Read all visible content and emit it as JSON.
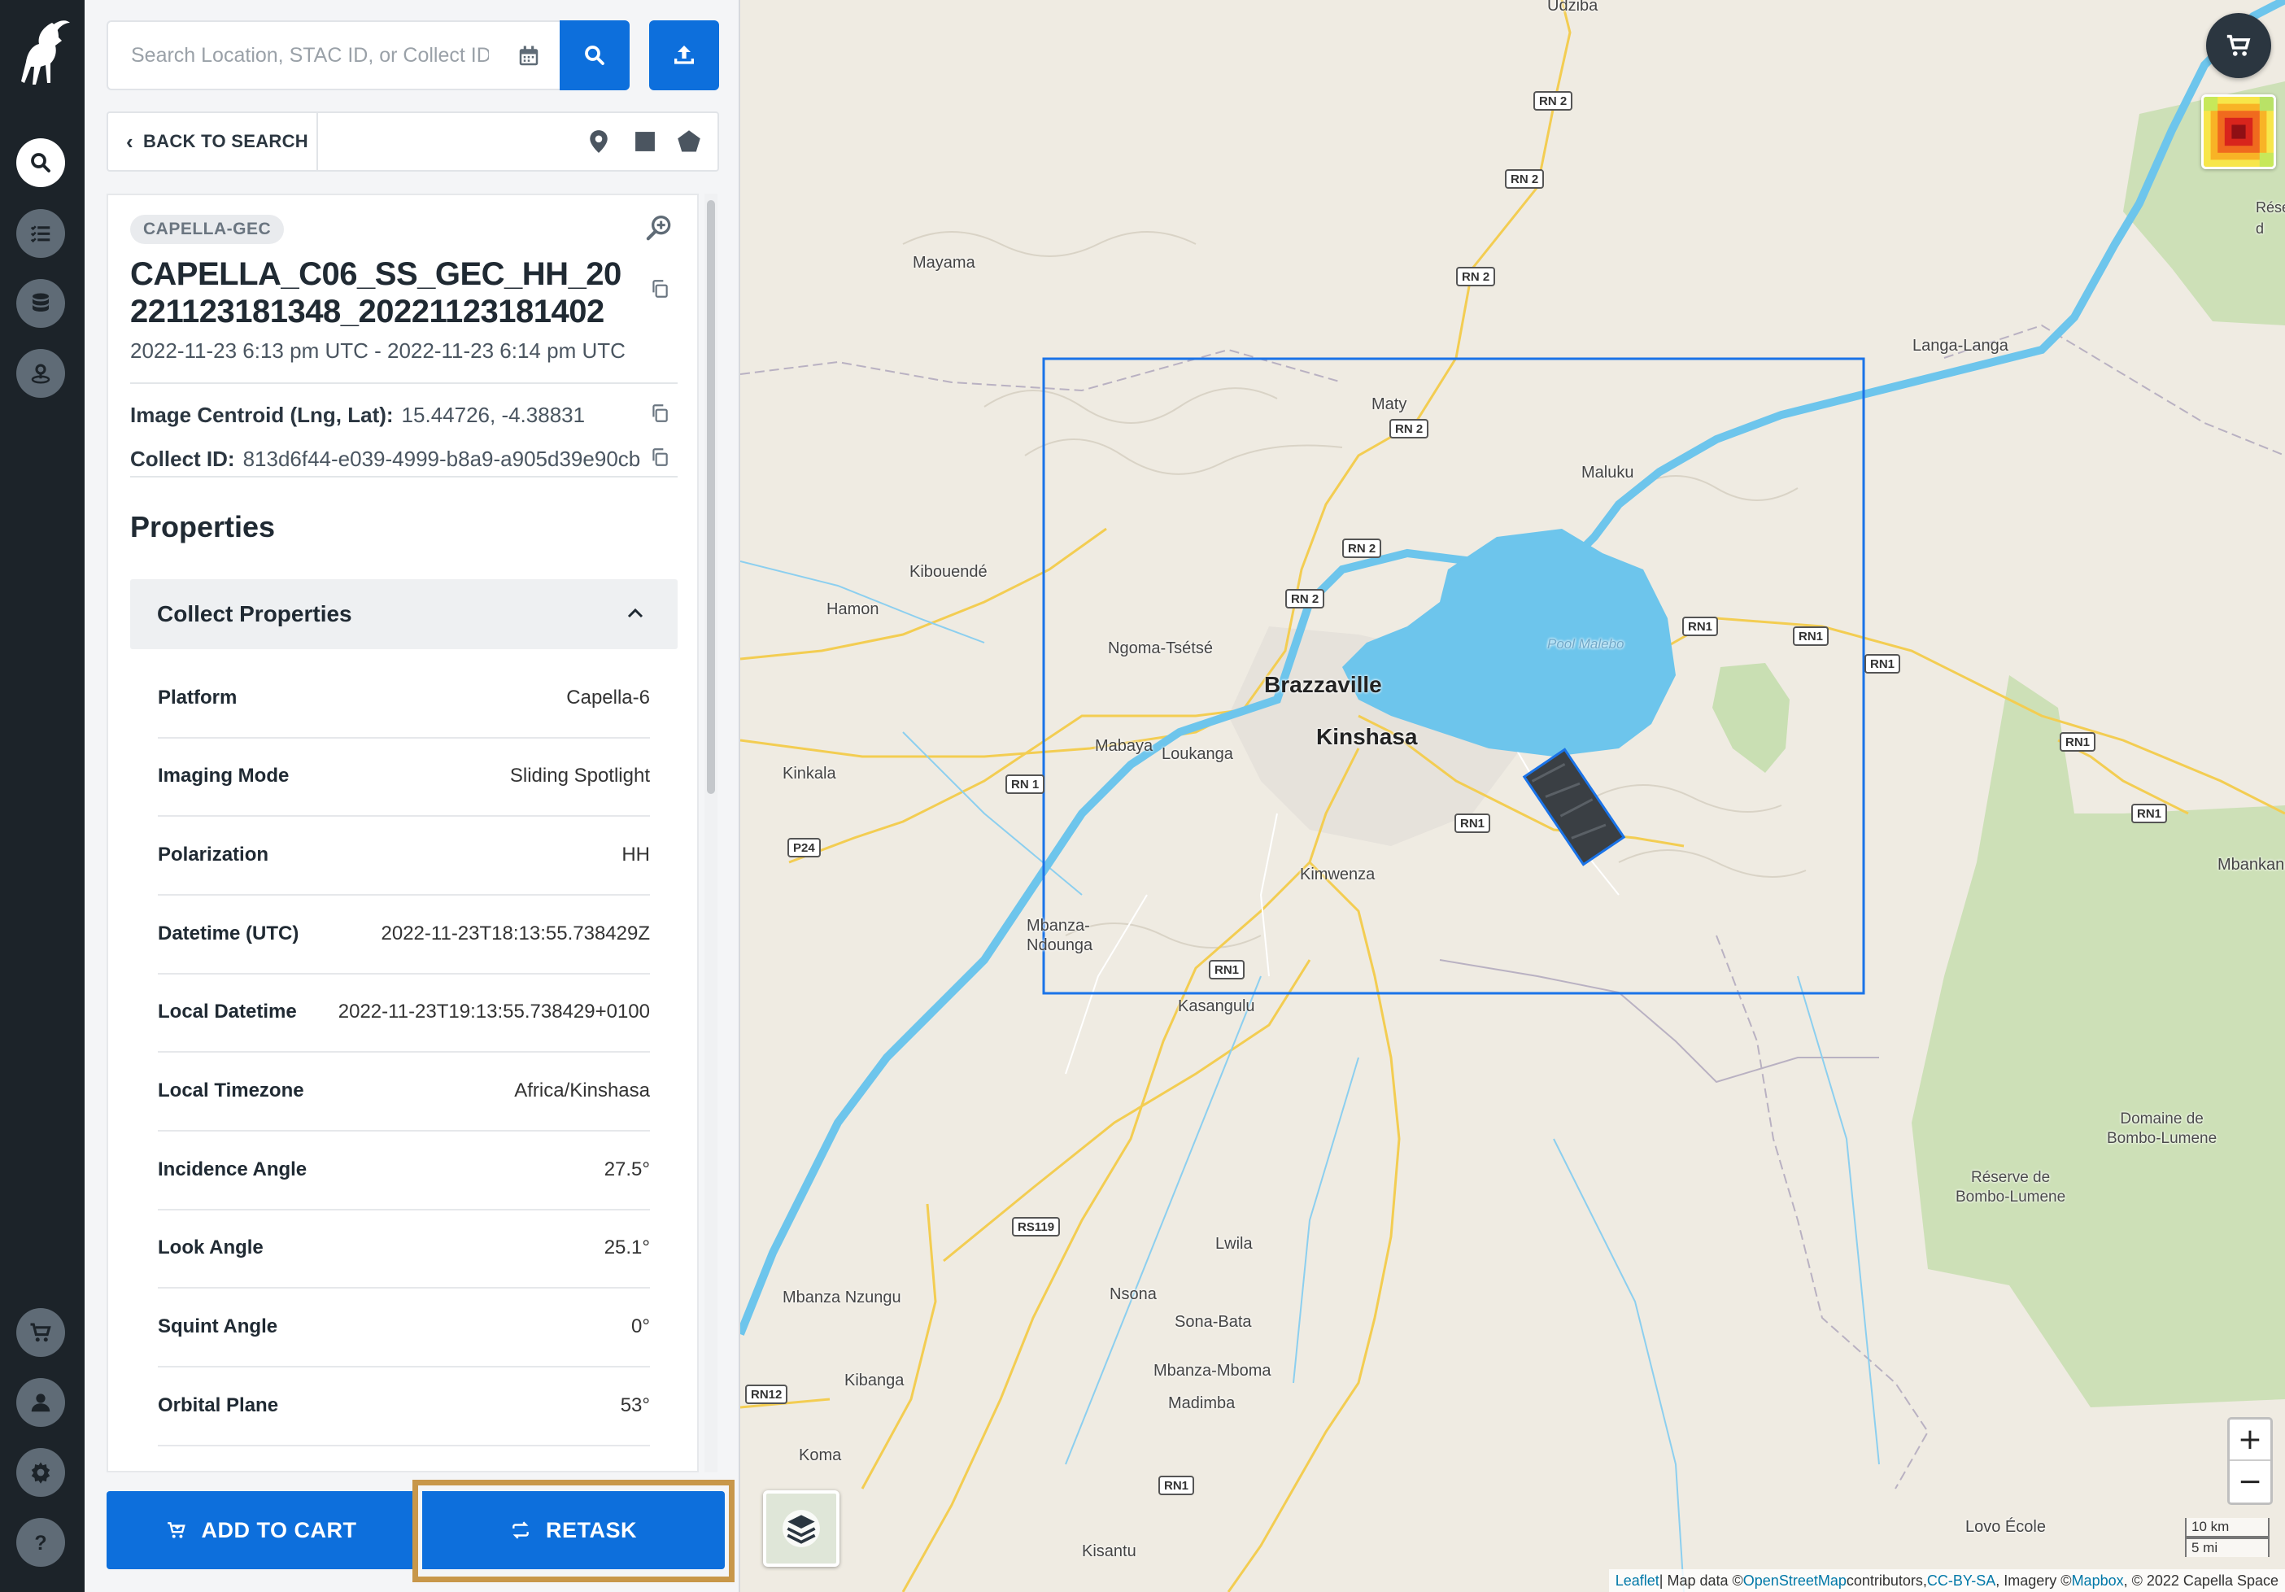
{
  "search": {
    "placeholder": "Search Location, STAC ID, or Collect ID"
  },
  "toolbar": {
    "back_label": "BACK TO SEARCH"
  },
  "detail": {
    "collection_badge": "CAPELLA-GEC",
    "title": "CAPELLA_C06_SS_GEC_HH_20221123181348_20221123181402",
    "datetime_range": "2022-11-23 6:13 pm UTC - 2022-11-23 6:14 pm UTC",
    "centroid_label": "Image Centroid (Lng, Lat):",
    "centroid_value": "15.44726, -4.38831",
    "collect_id_label": "Collect ID:",
    "collect_id_value": "813d6f44-e039-4999-b8a9-a905d39e90cb",
    "properties_heading": "Properties",
    "accordion_title": "Collect Properties",
    "properties": [
      {
        "key": "Platform",
        "value": "Capella-6"
      },
      {
        "key": "Imaging Mode",
        "value": "Sliding Spotlight"
      },
      {
        "key": "Polarization",
        "value": "HH"
      },
      {
        "key": "Datetime (UTC)",
        "value": "2022-11-23T18:13:55.738429Z"
      },
      {
        "key": "Local Datetime",
        "value": "2022-11-23T19:13:55.738429+0100"
      },
      {
        "key": "Local Timezone",
        "value": "Africa/Kinshasa"
      },
      {
        "key": "Incidence Angle",
        "value": "27.5°"
      },
      {
        "key": "Look Angle",
        "value": "25.1°"
      },
      {
        "key": "Squint Angle",
        "value": "0°"
      },
      {
        "key": "Orbital Plane",
        "value": "53°"
      }
    ]
  },
  "actions": {
    "add_to_cart": "ADD TO CART",
    "retask": "RETASK"
  },
  "map": {
    "labels": {
      "udziba": "Udziba",
      "mayama": "Mayama",
      "maty": "Maty",
      "langa_langa": "Langa-Langa",
      "maluku": "Maluku",
      "kibouende": "Kibouendé",
      "hamon": "Hamon",
      "ngoma": "Ngoma-Tsétsé",
      "pool_malebo": "Pool Malebo",
      "brazzaville": "Brazzaville",
      "kinshasa": "Kinshasa",
      "mabaya": "Mabaya",
      "loukanga": "Loukanga",
      "kinkala": "Kinkala",
      "kimwenza": "Kimwenza",
      "mbanza_ndounga": "Mbanza-\nNdounga",
      "kasangulu": "Kasangulu",
      "mbankana": "Mbankana",
      "domaine": "Domaine de\nBombo-Lumene",
      "reserve": "Réserve de\nBombo-Lumene",
      "lwila": "Lwila",
      "nsona": "Nsona",
      "sona_bata": "Sona-Bata",
      "mbanza_nzungu": "Mbanza Nzungu",
      "kibanga": "Kibanga",
      "mbanza_mboma": "Mbanza-Mboma",
      "madimba": "Madimba",
      "koma": "Koma",
      "kisantu": "Kisantu",
      "lovo_ecole": "Lovo École",
      "rese_d": "Rése\nd"
    },
    "roads": {
      "rn2": "RN 2",
      "rn1a": "RN 1",
      "rn1": "RN1",
      "p24": "P24",
      "rs119": "RS119",
      "rn12": "RN12"
    },
    "scale_km": "10 km",
    "scale_mi": "5 mi",
    "attribution": {
      "leaflet": "Leaflet",
      "map_data": " | Map data © ",
      "osm": "OpenStreetMap",
      "contributors": " contributors, ",
      "ccbysa": "CC-BY-SA",
      "imagery": ", Imagery © ",
      "mapbox": "Mapbox",
      "capella": ", © 2022 Capella Space"
    },
    "zoom_in": "+",
    "zoom_out": "−"
  },
  "colors": {
    "primary": "#0d6fdc",
    "rail": "#1c2329",
    "highlight": "#c8974a",
    "footprint": "#1a73e8",
    "water": "#6dc5ec"
  }
}
